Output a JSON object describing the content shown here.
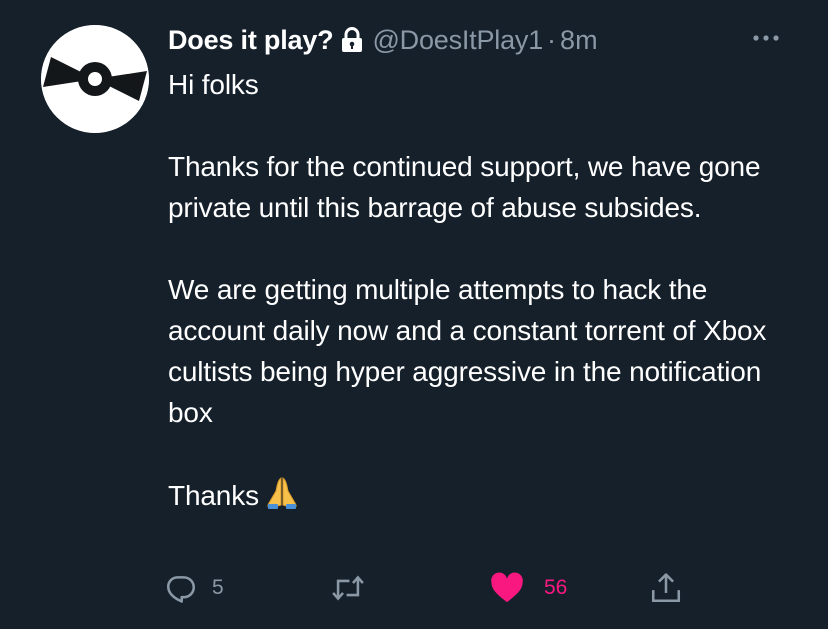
{
  "tweet": {
    "author": {
      "display_name": "Does it play?",
      "handle": "@DoesItPlay1",
      "protected_icon": "lock-icon",
      "avatar_icon": "disc-icon"
    },
    "separator": "·",
    "timestamp": "8m",
    "more_icon": "more-horizontal-icon",
    "paragraphs": [
      "Hi folks",
      "Thanks for the continued support, we have gone private until this barrage of abuse subsides.",
      "We are getting multiple attempts to hack the account daily now and a constant torrent of Xbox cultists being hyper aggressive in the notification box",
      "Thanks"
    ],
    "closing_emoji": "folded-hands-icon",
    "actions": {
      "reply_count": "5",
      "retweet_count": "",
      "like_count": "56",
      "liked": true
    }
  },
  "colors": {
    "background": "#15202b",
    "text": "#ffffff",
    "secondary_text": "#8b98a5",
    "like": "#f91880"
  }
}
